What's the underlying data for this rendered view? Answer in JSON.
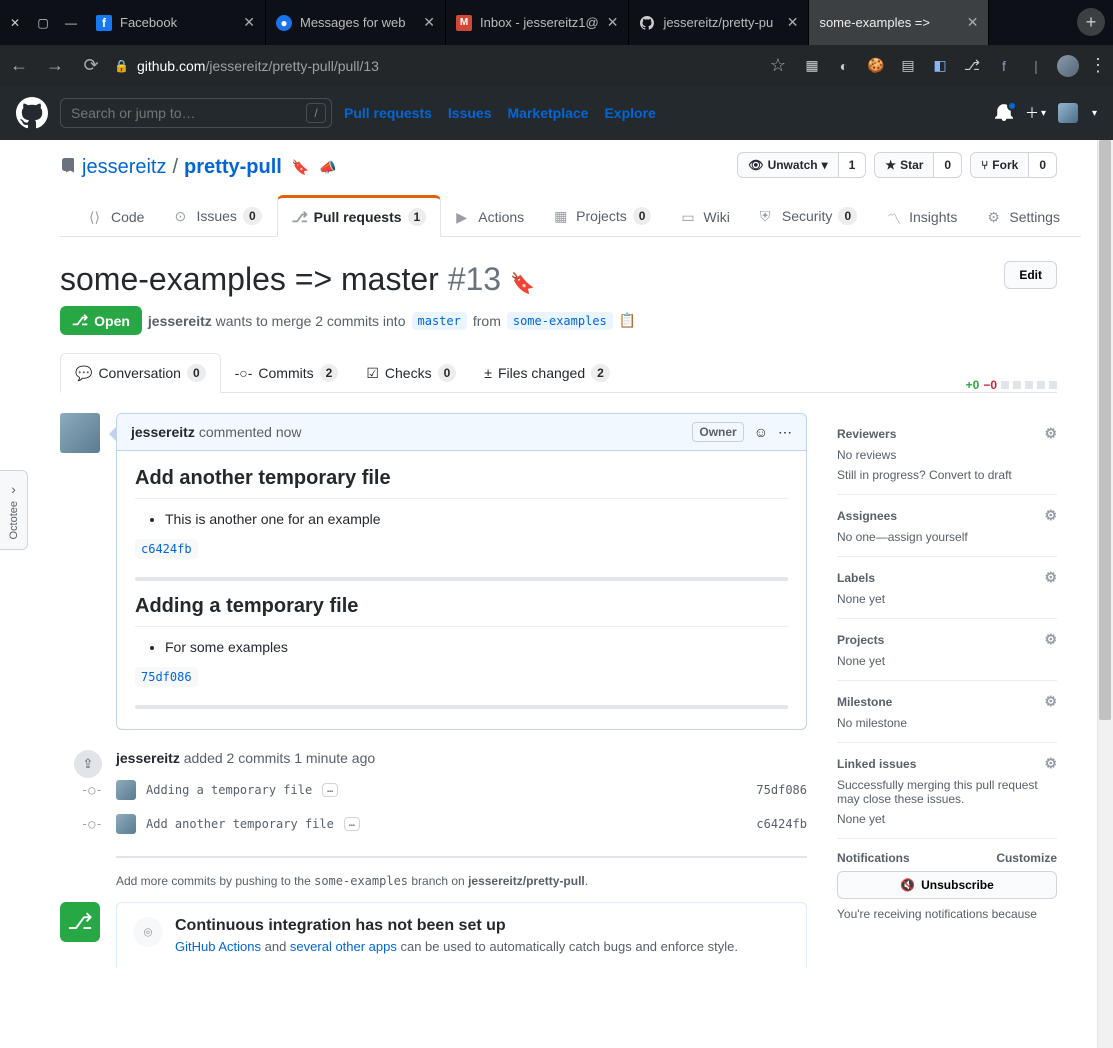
{
  "window": {
    "tabs": [
      {
        "label": "Facebook",
        "favicon": "f"
      },
      {
        "label": "Messages for web",
        "favicon": "○"
      },
      {
        "label": "Inbox - jessereitz1@",
        "favicon": "M"
      },
      {
        "label": "jessereitz/pretty-pu",
        "favicon": "⎇"
      },
      {
        "label": "some-examples =>",
        "favicon": "⎇",
        "active": true
      }
    ],
    "url_host": "github.com",
    "url_path": "/jessereitz/pretty-pull/pull/13"
  },
  "gh": {
    "search_placeholder": "Search or jump to…",
    "nav": [
      "Pull requests",
      "Issues",
      "Marketplace",
      "Explore"
    ]
  },
  "repo": {
    "owner": "jessereitz",
    "name": "pretty-pull",
    "actions": {
      "unwatch": "Unwatch",
      "unwatch_count": "1",
      "star": "Star",
      "star_count": "0",
      "fork": "Fork",
      "fork_count": "0"
    },
    "tabs": {
      "code": "Code",
      "issues": "Issues",
      "issues_n": "0",
      "prs": "Pull requests",
      "prs_n": "1",
      "actions": "Actions",
      "projects": "Projects",
      "projects_n": "0",
      "wiki": "Wiki",
      "security": "Security",
      "security_n": "0",
      "insights": "Insights",
      "settings": "Settings"
    }
  },
  "pr": {
    "title": "some-examples => master",
    "number": "#13",
    "edit": "Edit",
    "state": "Open",
    "author": "jessereitz",
    "meta_pre": " wants to merge 2 commits into ",
    "base": "master",
    "meta_mid": "from",
    "head": "some-examples",
    "tabs": {
      "conv": "Conversation",
      "conv_n": "0",
      "commits": "Commits",
      "commits_n": "2",
      "checks": "Checks",
      "checks_n": "0",
      "files": "Files changed",
      "files_n": "2"
    },
    "diff": {
      "add": "+0",
      "del": "−0"
    }
  },
  "comment": {
    "author": "jessereitz",
    "action": "commented now",
    "owner_badge": "Owner",
    "h1": "Add another temporary file",
    "b1": "This is another one for an example",
    "sha1": "c6424fb",
    "h2": "Adding a temporary file",
    "b2": "For some examples",
    "sha2": "75df086"
  },
  "events": {
    "added": {
      "author": "jessereitz",
      "text": " added 2 commits 1 minute ago"
    },
    "commits": [
      {
        "msg": "Adding a temporary file",
        "sha": "75df086"
      },
      {
        "msg": "Add another temporary file",
        "sha": "c6424fb"
      }
    ]
  },
  "push_hint": {
    "pre": "Add more commits by pushing to the ",
    "branch": "some-examples",
    "mid": " branch on ",
    "repo": "jessereitz/pretty-pull",
    "post": "."
  },
  "ci": {
    "title": "Continuous integration has not been set up",
    "link1": "GitHub Actions",
    "mid1": " and ",
    "link2": "several other apps",
    "post": " can be used to automatically catch bugs and enforce style."
  },
  "sidebar": {
    "reviewers": {
      "h": "Reviewers",
      "none": "No reviews",
      "draft": "Still in progress? Convert to draft"
    },
    "assignees": {
      "h": "Assignees",
      "none": "No one—assign yourself"
    },
    "labels": {
      "h": "Labels",
      "none": "None yet"
    },
    "projects": {
      "h": "Projects",
      "none": "None yet"
    },
    "milestone": {
      "h": "Milestone",
      "none": "No milestone"
    },
    "linked": {
      "h": "Linked issues",
      "desc": "Successfully merging this pull request may close these issues.",
      "none": "None yet"
    },
    "notif": {
      "h": "Notifications",
      "customize": "Customize",
      "unsub": "Unsubscribe",
      "reason": "You're receiving notifications because"
    }
  },
  "octotree": "Octotee"
}
